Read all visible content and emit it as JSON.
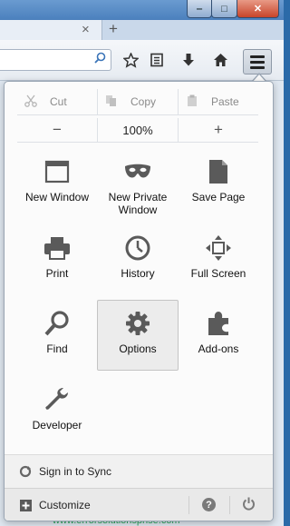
{
  "window": {
    "min_glyph": "‒",
    "max_glyph": "□",
    "close_glyph": "✕"
  },
  "tabs": {
    "close_glyph": "×",
    "new_tab_glyph": "+"
  },
  "menu": {
    "edit": [
      {
        "label": "Cut",
        "icon": "scissors-icon"
      },
      {
        "label": "Copy",
        "icon": "copy-icon"
      },
      {
        "label": "Paste",
        "icon": "paste-icon"
      }
    ],
    "zoom": {
      "minus": "−",
      "value": "100%",
      "plus": "+"
    },
    "items": [
      {
        "label": "New Window",
        "icon": "new-window-icon"
      },
      {
        "label": "New Private Window",
        "icon": "private-mask-icon"
      },
      {
        "label": "Save Page",
        "icon": "save-page-icon"
      },
      {
        "label": "Print",
        "icon": "printer-icon"
      },
      {
        "label": "History",
        "icon": "clock-icon"
      },
      {
        "label": "Full Screen",
        "icon": "fullscreen-icon"
      },
      {
        "label": "Find",
        "icon": "magnifier-icon"
      },
      {
        "label": "Options",
        "icon": "gear-icon"
      },
      {
        "label": "Add-ons",
        "icon": "puzzle-icon"
      },
      {
        "label": "Developer",
        "icon": "wrench-icon"
      }
    ],
    "selected_item": "Options",
    "sync_label": "Sign in to Sync",
    "customize_label": "Customize",
    "help_glyph": "?"
  },
  "watermark": "www.errorsolutionsprise.com",
  "colors": {
    "icon": "#5a5a5a",
    "selected_bg": "#ececec",
    "accent": "#3a74b8"
  }
}
